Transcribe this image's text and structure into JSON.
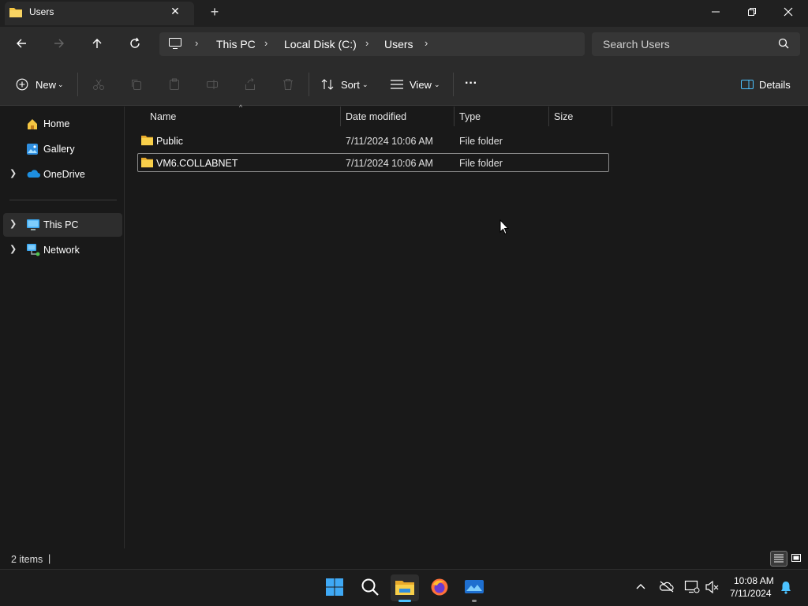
{
  "tab": {
    "title": "Users",
    "close_glyph": "✕",
    "new_tab_glyph": "+"
  },
  "window_controls": {
    "minimize": "minimize-icon",
    "restore": "restore-icon",
    "close": "close-icon"
  },
  "breadcrumb": [
    "This PC",
    "Local Disk (C:)",
    "Users"
  ],
  "search": {
    "placeholder": "Search Users"
  },
  "command_bar": {
    "new_label": "New",
    "sort_label": "Sort",
    "view_label": "View",
    "more_label": "···",
    "details_label": "Details"
  },
  "navigation": {
    "items": [
      {
        "label": "Home",
        "icon": "home-icon",
        "expandable": false
      },
      {
        "label": "Gallery",
        "icon": "gallery-icon",
        "expandable": false
      },
      {
        "label": "OneDrive",
        "icon": "cloud-icon",
        "expandable": true
      },
      {
        "label": "This PC",
        "icon": "pc-icon",
        "expandable": true,
        "selected": true
      },
      {
        "label": "Network",
        "icon": "network-icon",
        "expandable": true
      }
    ]
  },
  "columns": [
    "Name",
    "Date modified",
    "Type",
    "Size"
  ],
  "files": [
    {
      "name": "Public",
      "date": "7/11/2024 10:06 AM",
      "type": "File folder",
      "size": ""
    },
    {
      "name": "VM6.COLLABNET",
      "date": "7/11/2024 10:06 AM",
      "type": "File folder",
      "size": ""
    }
  ],
  "status": {
    "count": "2 items",
    "cursor": "|"
  },
  "taskbar": {
    "clock_time": "10:08 AM",
    "clock_date": "7/11/2024"
  },
  "colors": {
    "folder": "#f4c542",
    "accent": "#4cc2ff",
    "selected_row_border": "#8a8a8a"
  }
}
